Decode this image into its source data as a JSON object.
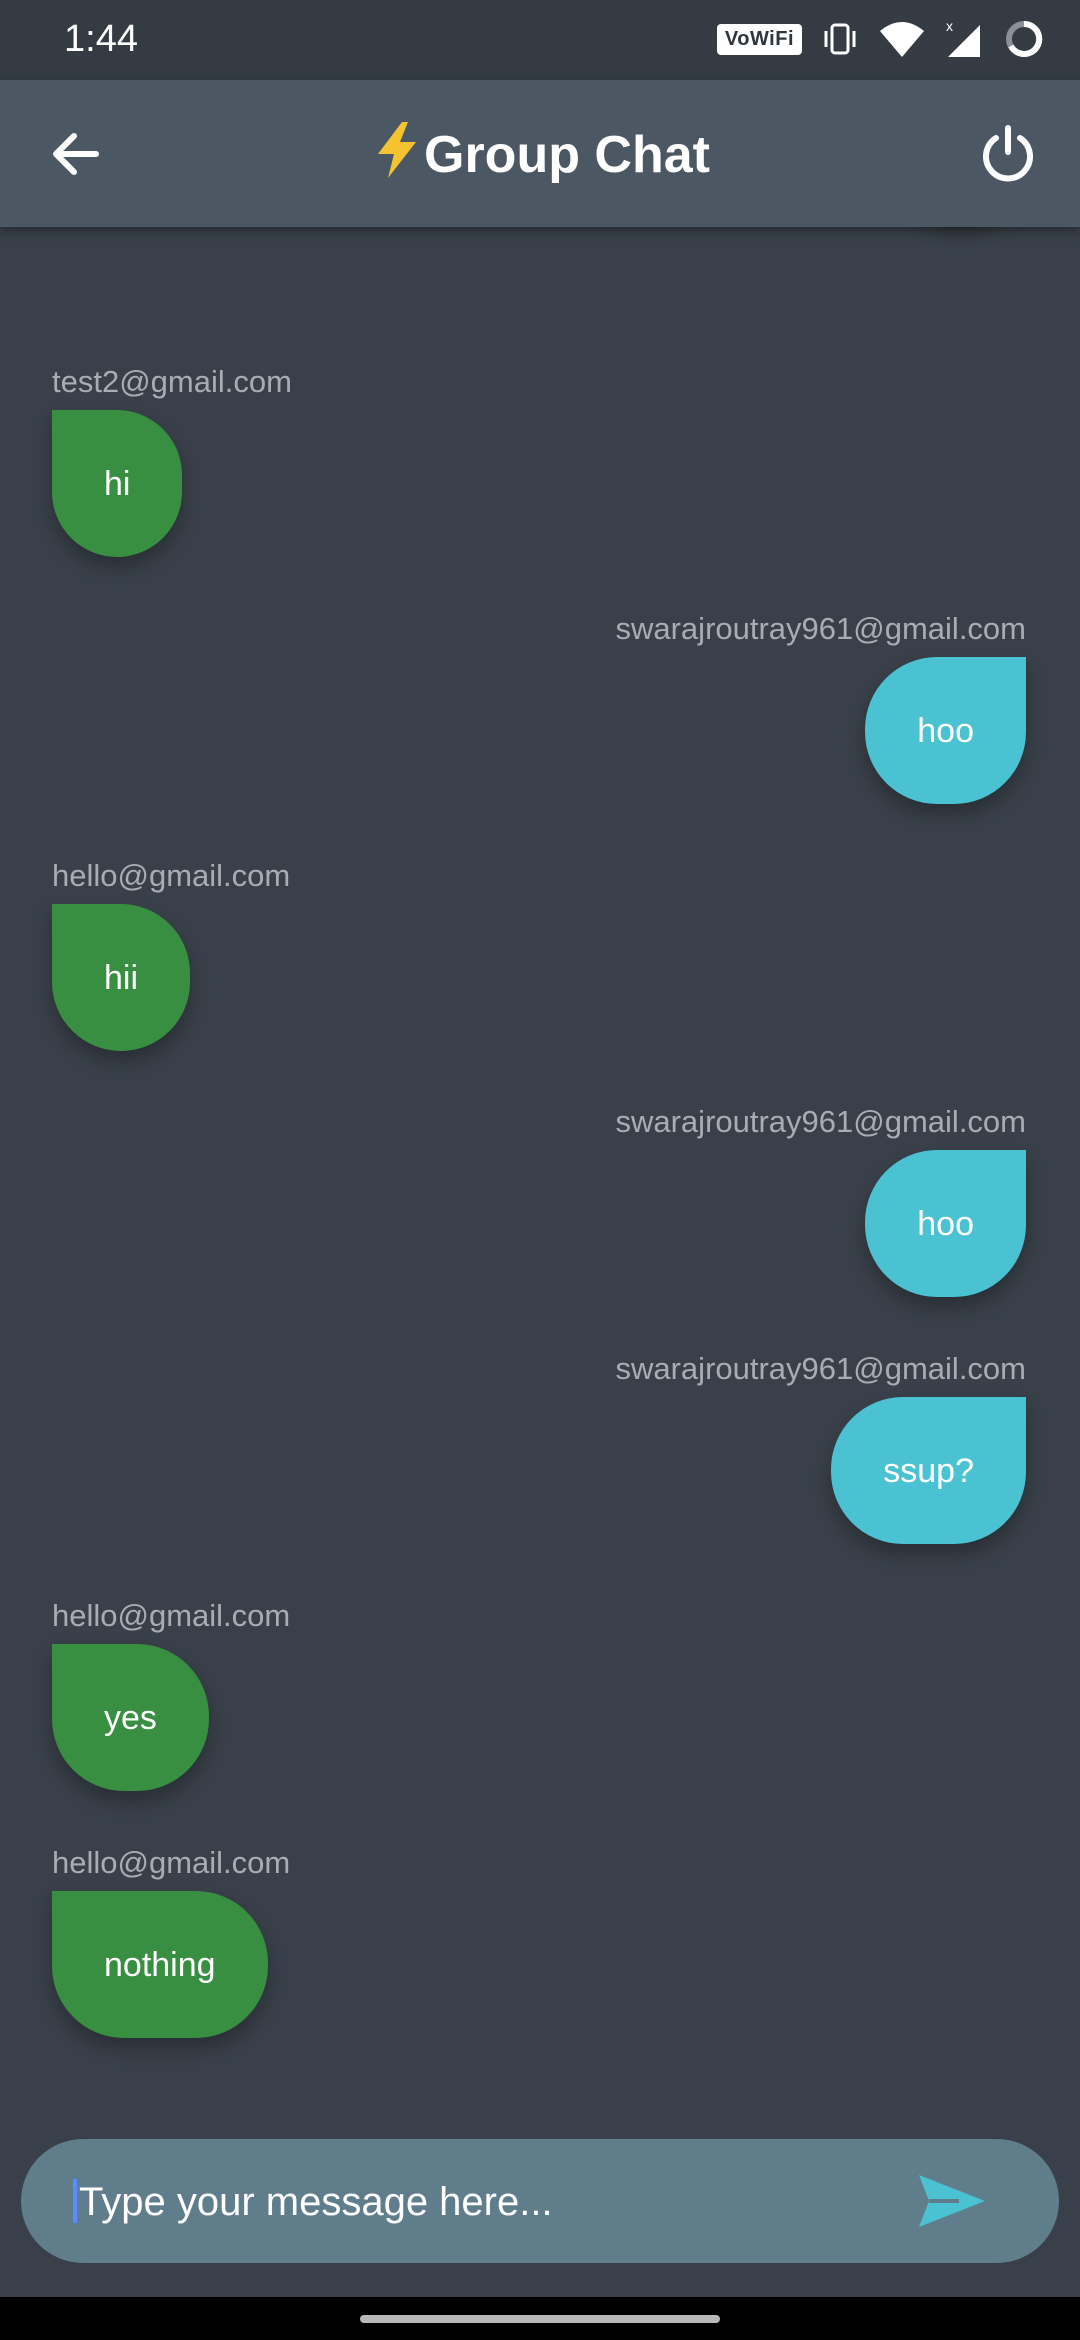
{
  "status_bar": {
    "time": "1:44",
    "vowifi_label": "VoWiFi",
    "icons": [
      "vibrate-icon",
      "wifi-icon",
      "signal-icon",
      "battery-icon"
    ]
  },
  "app_bar": {
    "title_emoji": "⚡",
    "title": "Group Chat",
    "back_icon": "arrow-left-icon",
    "power_icon": "power-icon"
  },
  "messages": [
    {
      "sender": "",
      "text": "hi",
      "mine": true
    },
    {
      "sender": "test2@gmail.com",
      "text": "hi",
      "mine": false
    },
    {
      "sender": "swarajroutray961@gmail.com",
      "text": "hoo",
      "mine": true
    },
    {
      "sender": "hello@gmail.com",
      "text": "hii",
      "mine": false
    },
    {
      "sender": "swarajroutray961@gmail.com",
      "text": "hoo",
      "mine": true
    },
    {
      "sender": "swarajroutray961@gmail.com",
      "text": "ssup?",
      "mine": true
    },
    {
      "sender": "hello@gmail.com",
      "text": "yes",
      "mine": false
    },
    {
      "sender": "hello@gmail.com",
      "text": "nothing",
      "mine": false
    }
  ],
  "composer": {
    "placeholder": "Type your message here...",
    "value": "",
    "send_icon": "send-icon"
  },
  "colors": {
    "background": "#394049",
    "app_bar": "#4b5763",
    "my_bubble": "#4ac2d2",
    "other_bubble": "#388e41",
    "composer": "#607d8b",
    "send_accent": "#4ac2d2"
  }
}
